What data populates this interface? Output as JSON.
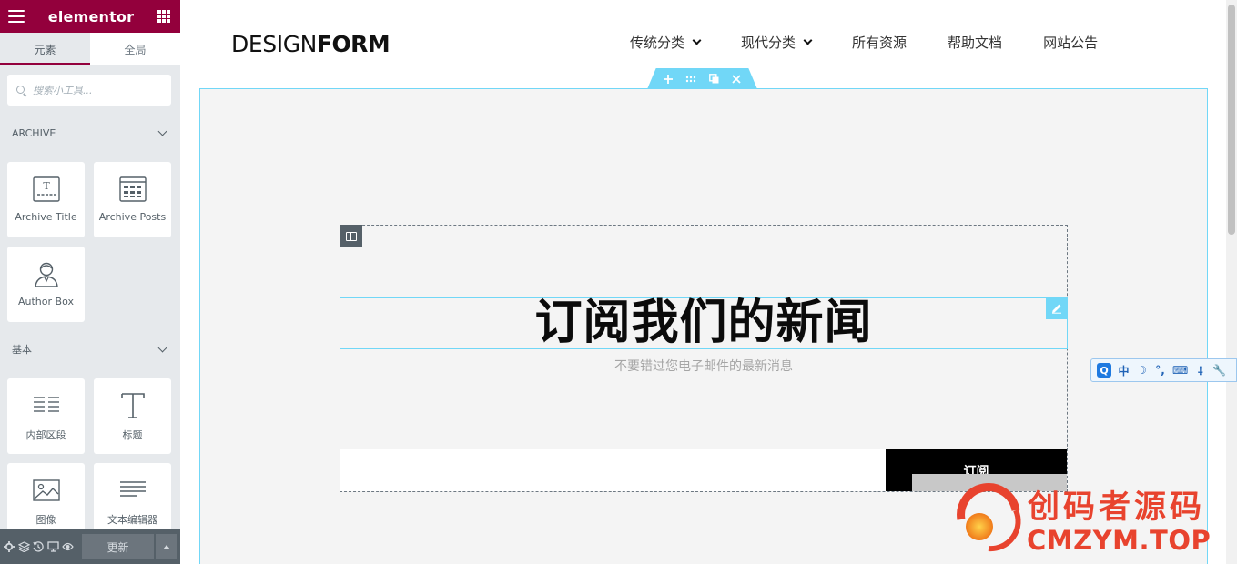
{
  "panel": {
    "brand": "elementor",
    "tabs": [
      {
        "label": "元素",
        "active": true
      },
      {
        "label": "全局",
        "active": false
      }
    ],
    "search_placeholder": "搜索小工具...",
    "categories": [
      {
        "title": "ARCHIVE",
        "widgets": [
          {
            "label": "Archive Title",
            "icon": "archive-title-icon"
          },
          {
            "label": "Archive Posts",
            "icon": "archive-posts-icon"
          },
          {
            "label": "Author Box",
            "icon": "author-box-icon"
          }
        ]
      },
      {
        "title": "基本",
        "widgets": [
          {
            "label": "内部区段",
            "icon": "inner-section-icon"
          },
          {
            "label": "标题",
            "icon": "heading-icon"
          },
          {
            "label": "图像",
            "icon": "image-icon"
          },
          {
            "label": "文本编辑器",
            "icon": "text-editor-icon"
          }
        ]
      }
    ],
    "footer": {
      "update_label": "更新"
    }
  },
  "site": {
    "logo_thin": "DESIGN",
    "logo_bold": "FORM",
    "nav": [
      {
        "label": "传统分类",
        "dropdown": true
      },
      {
        "label": "现代分类",
        "dropdown": true
      },
      {
        "label": "所有资源",
        "dropdown": false
      },
      {
        "label": "帮助文档",
        "dropdown": false
      },
      {
        "label": "网站公告",
        "dropdown": false
      }
    ]
  },
  "content": {
    "heading": "订阅我们的新闻",
    "subtitle": "不要错过您电子邮件的最新消息",
    "subscribe_label": "订阅",
    "email_value": ""
  },
  "ime": {
    "items": [
      "Q",
      "中",
      "☽",
      "°,",
      "⌨",
      "⸸",
      "🔧"
    ]
  },
  "watermark": {
    "cn": "创码者源码",
    "en": "CMZYM.TOP"
  },
  "colors": {
    "brand": "#93003c",
    "panel_bg": "#e6e9ec",
    "section_outline": "#71d7f7",
    "column_handle": "#556068",
    "watermark": "#e8432e"
  }
}
